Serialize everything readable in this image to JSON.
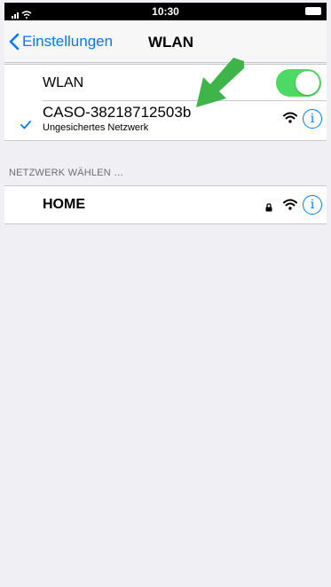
{
  "status_bar": {
    "time": "10:30",
    "icons": [
      "signal-icon",
      "wifi-icon",
      "battery-icon"
    ]
  },
  "nav": {
    "back_label": "Einstellungen",
    "title": "WLAN"
  },
  "wlan_toggle": {
    "label": "WLAN",
    "on": true,
    "color": "#4cd964"
  },
  "connected_network": {
    "name": "CASO-38218712503b",
    "subtitle": "Ungesichertes Netzwerk",
    "selected": true,
    "info_label": "i"
  },
  "network_section": {
    "header": "NETZWERK WÄHLEN …",
    "networks": [
      {
        "name": "HOME",
        "locked": true,
        "info_label": "i"
      }
    ]
  },
  "annotation": {
    "type": "arrow",
    "color": "#3fb549"
  },
  "colors": {
    "accent": "#007aff",
    "background": "#efeff4"
  }
}
